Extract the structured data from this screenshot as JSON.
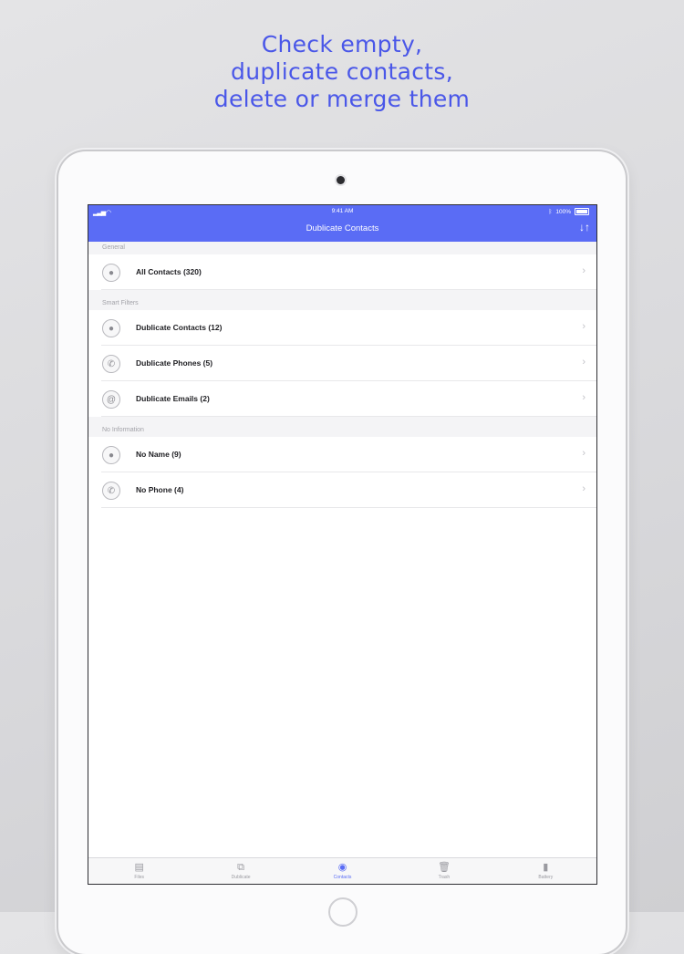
{
  "headline": {
    "line1": "Check empty,",
    "line2": "duplicate contacts,",
    "line3": "delete or merge them"
  },
  "status_bar": {
    "time": "9:41 AM",
    "battery": "100%"
  },
  "navbar": {
    "title": "Dublicate Contacts",
    "sort_icon": "sort-arrows-icon"
  },
  "sections": [
    {
      "header": "General",
      "rows": [
        {
          "label": "All Contacts (320)",
          "icon": "person-icon"
        }
      ]
    },
    {
      "header": "Smart Filters",
      "rows": [
        {
          "label": "Dublicate Contacts (12)",
          "icon": "people-icon"
        },
        {
          "label": "Dublicate Phones (5)",
          "icon": "phone-icon"
        },
        {
          "label": "Dublicate Emails (2)",
          "icon": "at-icon"
        }
      ]
    },
    {
      "header": "No Information",
      "rows": [
        {
          "label": "No Name (9)",
          "icon": "no-name-icon"
        },
        {
          "label": "No Phone (4)",
          "icon": "no-phone-icon"
        }
      ]
    }
  ],
  "tabbar": {
    "tabs": [
      {
        "label": "Files",
        "icon": "file-icon"
      },
      {
        "label": "Dublicate",
        "icon": "duplicate-icon"
      },
      {
        "label": "Contacts",
        "icon": "contact-icon"
      },
      {
        "label": "Trash",
        "icon": "trash-icon"
      },
      {
        "label": "Battery",
        "icon": "battery-icon"
      }
    ],
    "active": "Contacts"
  },
  "colors": {
    "accent": "#5a6cf5",
    "headline": "#4a57e8"
  }
}
